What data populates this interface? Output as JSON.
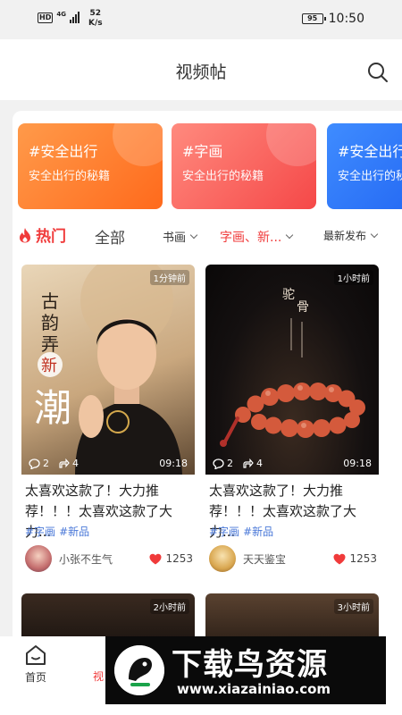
{
  "status_bar": {
    "network_badge": "HD",
    "network_type": "4G",
    "speed_value": "52",
    "speed_unit": "K/s",
    "battery": "95",
    "time": "10:50"
  },
  "nav": {
    "title": "视频帖",
    "search_icon": "search-icon"
  },
  "banners": [
    {
      "tag": "#安全出行",
      "subtitle": "安全出行的秘籍",
      "color": "#ff7a2e"
    },
    {
      "tag": "#字画",
      "subtitle": "安全出行的秘籍",
      "color": "#f75a52"
    },
    {
      "tag": "#安全出行",
      "subtitle": "安全出行的秘籍",
      "color": "#2a6ff2"
    }
  ],
  "filters": {
    "hot_label": "热门",
    "hot_icon": "flame-icon",
    "all_label": "全部",
    "dropdown_1": "书画",
    "dropdown_2": "字画、新...",
    "dropdown_3": "最新发布"
  },
  "cards": [
    {
      "time_ago": "1分钟前",
      "comments": "2",
      "shares": "4",
      "duration": "09:18",
      "title": "太喜欢这款了！大力推荐！！！太喜欢这款了大力...",
      "tags": [
        "#字画",
        "#新品"
      ],
      "author": "小张不生气",
      "likes": "1253",
      "poster_text": [
        "古",
        "韵",
        "弄",
        "新",
        "潮"
      ]
    },
    {
      "time_ago": "1小时前",
      "comments": "2",
      "shares": "4",
      "duration": "09:18",
      "title": "太喜欢这款了！大力推荐！！！太喜欢这款了大力...",
      "tags": [
        "#字画",
        "#新品"
      ],
      "author": "天天鉴宝",
      "likes": "1253",
      "poster_text": [
        "驼",
        "骨"
      ]
    }
  ],
  "row2": [
    {
      "time_ago": "2小时前"
    },
    {
      "time_ago": "3小时前"
    }
  ],
  "tabbar": {
    "home_label": "首页",
    "video_label": "视"
  },
  "watermark": {
    "title": "下载鸟资源",
    "url": "www.xiazainiao.com"
  },
  "colors": {
    "accent": "#f03a3a",
    "tag": "#4a78d8"
  }
}
